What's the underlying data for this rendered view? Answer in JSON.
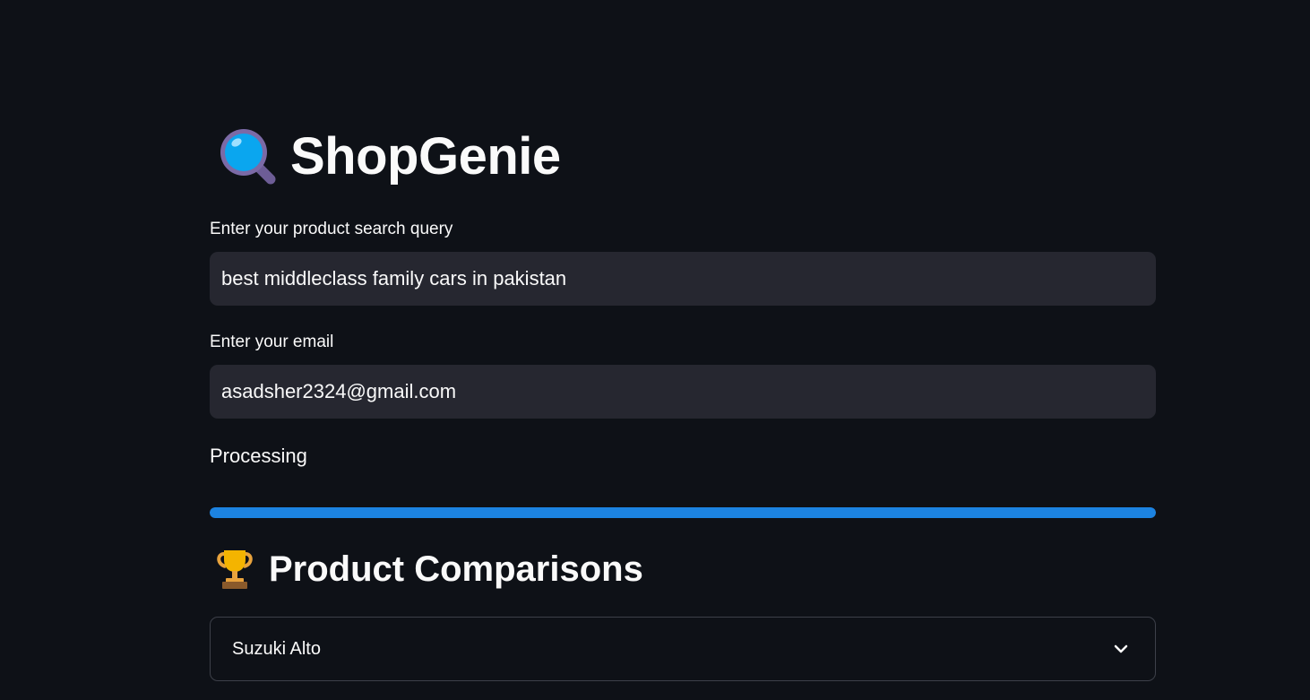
{
  "app": {
    "title": "ShopGenie",
    "title_icon": "magnifying-glass-icon"
  },
  "form": {
    "query_label": "Enter your product search query",
    "query_value": "best middleclass family cars in pakistan",
    "email_label": "Enter your email",
    "email_value": "asadsher2324@gmail.com"
  },
  "status": {
    "text": "Processing",
    "progress": 1.0,
    "progress_color": "#1c83e1"
  },
  "comparisons": {
    "heading": "Product Comparisons",
    "heading_icon": "trophy-icon",
    "items": [
      {
        "label": "Suzuki Alto",
        "expanded": false,
        "icon": "chevron-down-icon"
      }
    ]
  },
  "colors": {
    "background": "#0e1117",
    "input_background": "#262730",
    "text": "#fafafa",
    "accent": "#1c83e1"
  }
}
